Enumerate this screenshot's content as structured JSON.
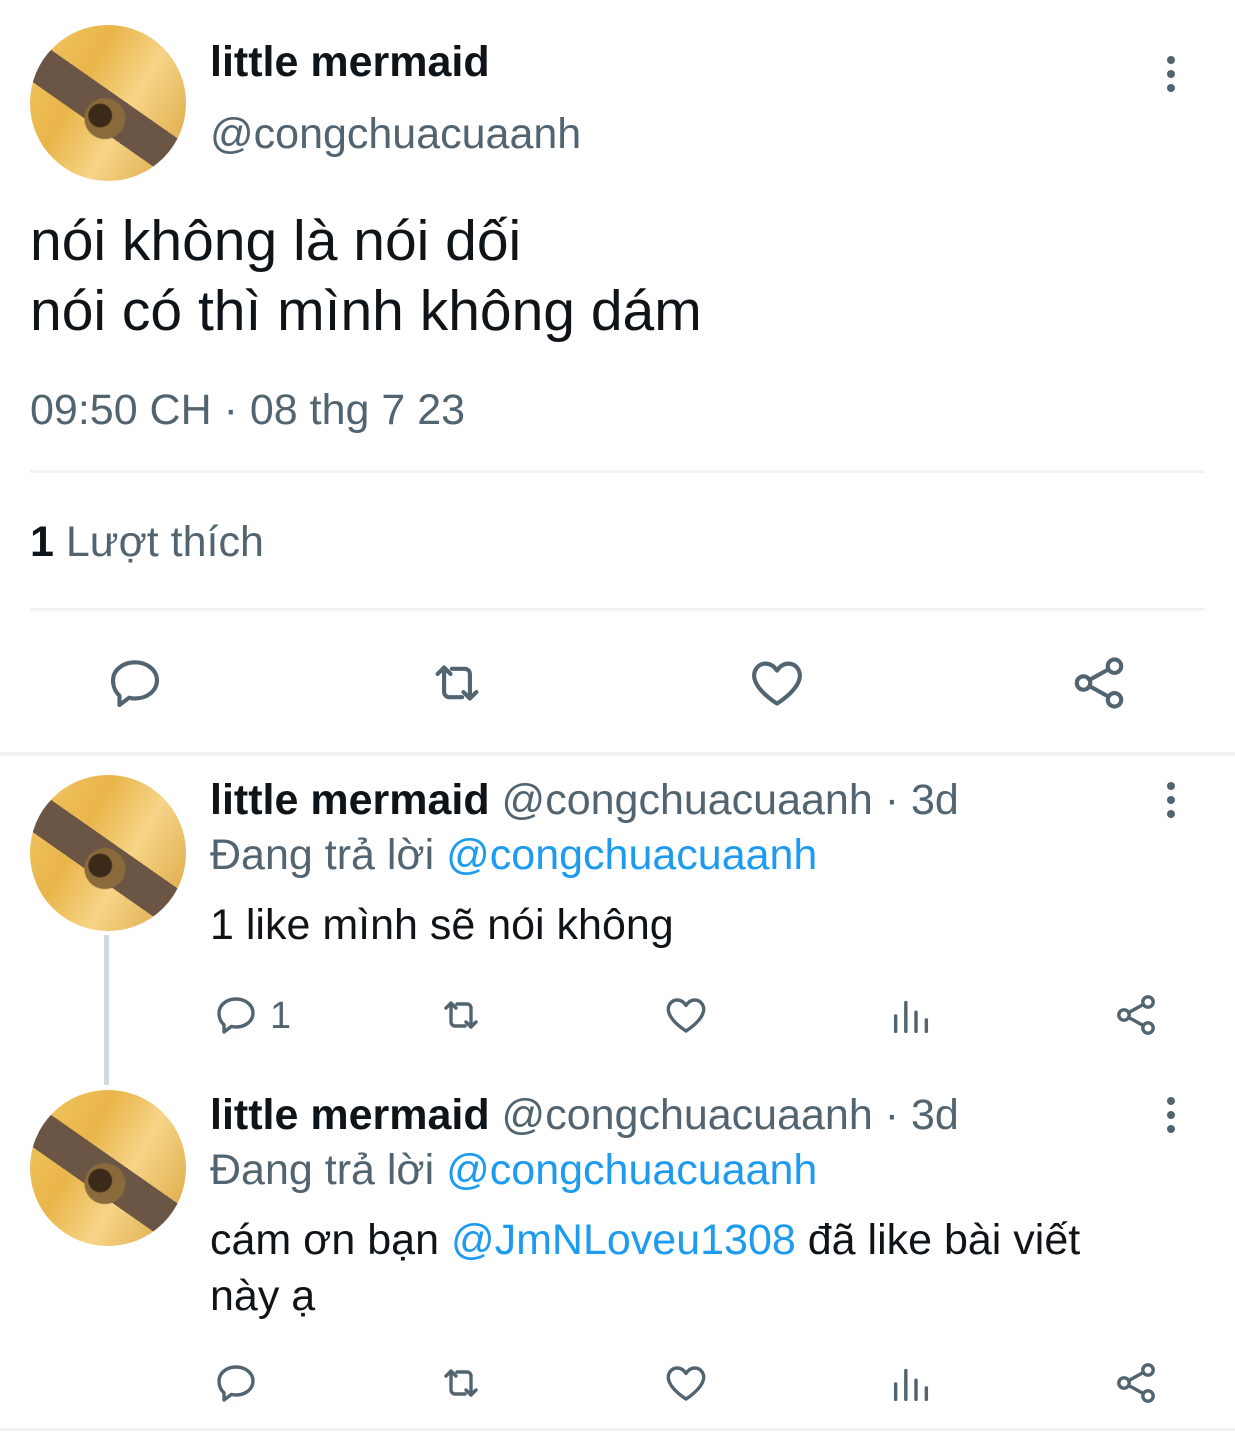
{
  "main_tweet": {
    "display_name": "little mermaid",
    "handle": "@congchuacuaanh",
    "text_line1": "nói không là nói dối",
    "text_line2": "nói có thì mình không dám",
    "timestamp": "09:50 CH · 08 thg 7 23",
    "likes_count": "1",
    "likes_label": "Lượt thích"
  },
  "replies": [
    {
      "display_name": "little mermaid",
      "handle_time": "@congchuacuaanh · 3d",
      "replying_prefix": "Đang trả lời",
      "replying_to": "@congchuacuaanh",
      "text": "1 like mình sẽ nói không",
      "reply_count": "1"
    },
    {
      "display_name": "little mermaid",
      "handle_time": "@congchuacuaanh · 3d",
      "replying_prefix": "Đang trả lời",
      "replying_to": "@congchuacuaanh",
      "text_before": "cám ơn bạn",
      "mention": "@JmNLoveu1308",
      "text_after": "đã like bài viết",
      "text_line2": "này ạ"
    }
  ],
  "icons": [
    "more-icon",
    "reply-icon",
    "retweet-icon",
    "like-icon",
    "share-icon",
    "views-icon"
  ],
  "colors": {
    "text": "#0f1419",
    "muted": "#536471",
    "link": "#1d9bf0",
    "divider": "#eff3f4"
  }
}
